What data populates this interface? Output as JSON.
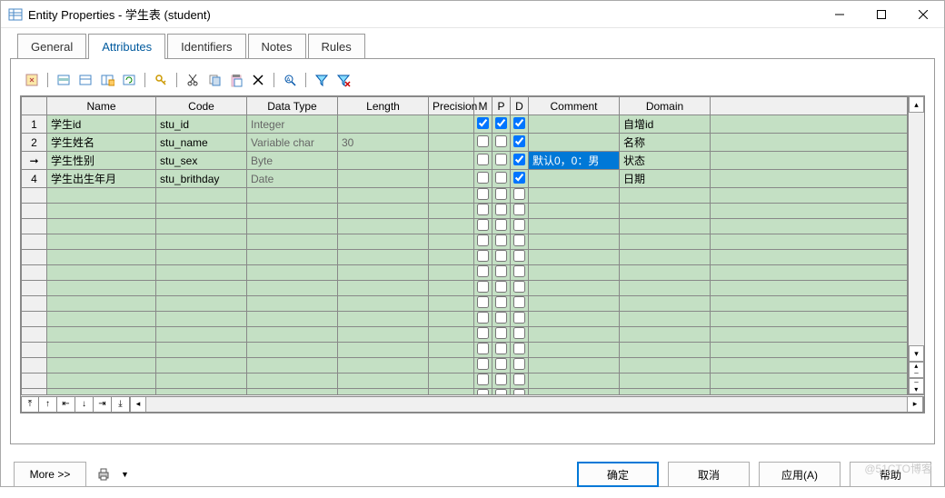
{
  "window": {
    "title": "Entity Properties - 学生表 (student)"
  },
  "tabs": {
    "general": "General",
    "attributes": "Attributes",
    "identifiers": "Identifiers",
    "notes": "Notes",
    "rules": "Rules",
    "active": "Attributes"
  },
  "columns": {
    "name": "Name",
    "code": "Code",
    "datatype": "Data Type",
    "length": "Length",
    "precision": "Precision",
    "m": "M",
    "p": "P",
    "d": "D",
    "comment": "Comment",
    "domain": "Domain"
  },
  "rows": [
    {
      "num": "1",
      "name": "学生id",
      "code": "stu_id",
      "datatype": "Integer",
      "length": "",
      "precision": "",
      "m": true,
      "p": true,
      "d": true,
      "comment": "",
      "domain": "自增id",
      "current": false,
      "selected": false
    },
    {
      "num": "2",
      "name": "学生姓名",
      "code": "stu_name",
      "datatype": "Variable char",
      "length": "30",
      "precision": "",
      "m": false,
      "p": false,
      "d": true,
      "comment": "",
      "domain": "名称",
      "current": false,
      "selected": false
    },
    {
      "num": "➞",
      "name": "学生性别",
      "code": "stu_sex",
      "datatype": "Byte",
      "length": "",
      "precision": "",
      "m": false,
      "p": false,
      "d": true,
      "comment": "默认0，0：男",
      "domain": "状态",
      "current": true,
      "selected": true
    },
    {
      "num": "4",
      "name": "学生出生年月",
      "code": "stu_brithday",
      "datatype": "Date",
      "length": "",
      "precision": "",
      "m": false,
      "p": false,
      "d": true,
      "comment": "",
      "domain": "日期",
      "current": false,
      "selected": false
    }
  ],
  "empty_rows": 14,
  "buttons": {
    "more": "More >>",
    "ok": "确定",
    "cancel": "取消",
    "apply": "应用(A)",
    "help": "帮助"
  },
  "watermark": "@51CTO博客"
}
